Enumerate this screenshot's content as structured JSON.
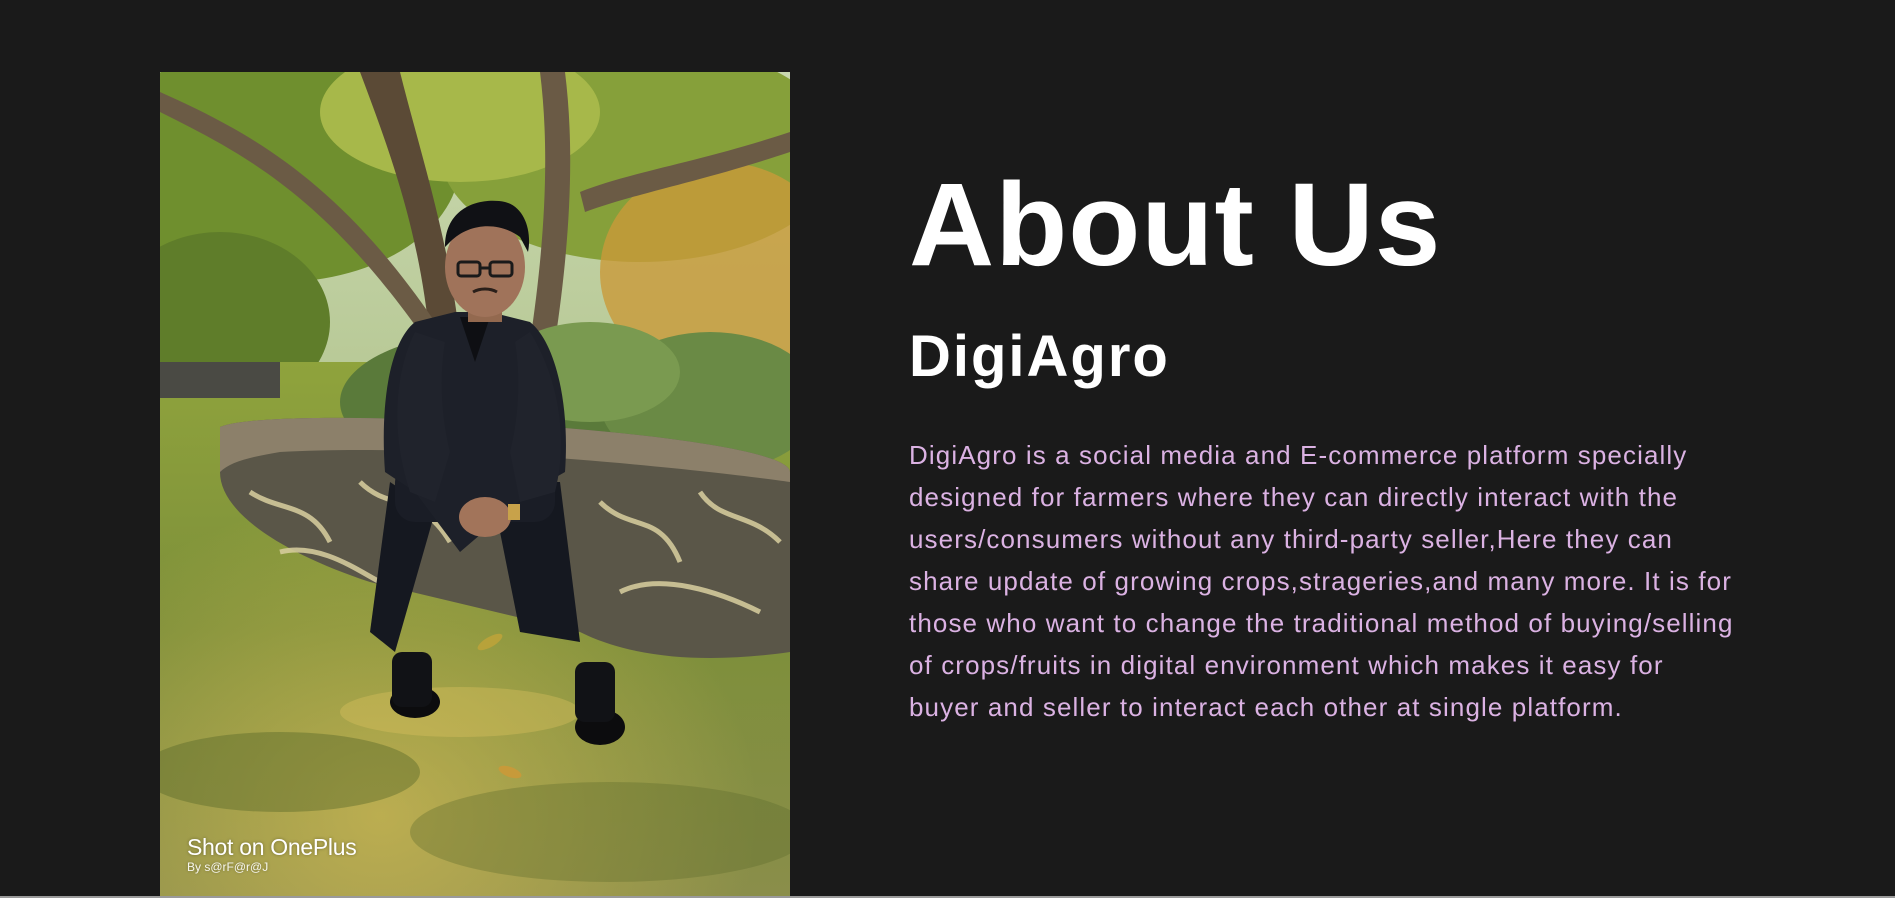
{
  "photo": {
    "watermark_line1": "Shot on OnePlus",
    "watermark_line2": "By s@rF@r@J"
  },
  "about": {
    "heading": "About Us",
    "subheading": "DigiAgro",
    "description": "DigiAgro is a social media and E-commerce platform specially designed for farmers where they can directly interact with the users/consumers without any third-party seller,Here they can share update of growing crops,strageries,and many more. It is for those who want to change the traditional method of buying/selling of crops/fruits in digital environment which makes it easy for buyer and seller to interact each other at single platform."
  },
  "colors": {
    "background": "#1a1a1a",
    "heading": "#ffffff",
    "description": "#dbb2e3"
  }
}
